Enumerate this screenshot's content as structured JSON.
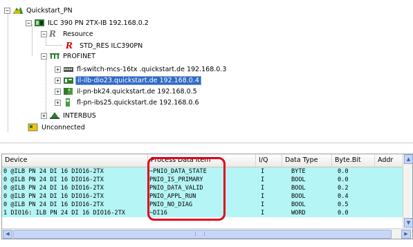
{
  "tree": {
    "root": "Quickstart_PN",
    "controller": "ILC 390 PN 2TX-IB 192.168.0.2",
    "resource": "Resource",
    "std_res": "STD_RES ILC390PN",
    "profinet": "PROFINET",
    "devices": [
      {
        "label": "fl-switch-mcs-16tx .quickstart.de 192.168.0.3",
        "selected": false
      },
      {
        "label": "il-ilb-dio23.quickstart.de 192.168.0.4",
        "selected": true
      },
      {
        "label": "il-pn-bk24.quickstart.de 192.168.0.5",
        "selected": false
      },
      {
        "label": "fl-pn-ibs25.quickstart.de 192.168.0.6",
        "selected": false
      }
    ],
    "interbus": "INTERBUS",
    "unconnected": "Unconnected",
    "expanders": {
      "minus": "−",
      "plus": "+"
    },
    "resource_glyph": "R"
  },
  "table": {
    "columns": [
      "Device",
      "Process Data Item",
      "I/Q",
      "Data Type",
      "Byte.Bit",
      "Addr"
    ],
    "rows": [
      [
        "0 @ILB PN 24 DI 16 DIO16-2TX",
        "~PNIO_DATA_STATE",
        "I",
        "BYTE",
        "0.0"
      ],
      [
        "0 @ILB PN 24 DI 16 DIO16-2TX",
        "PNIO_IS_PRIMARY",
        "I",
        "BOOL",
        "0.0"
      ],
      [
        "0 @ILB PN 24 DI 16 DIO16-2TX",
        "PNIO_DATA_VALID",
        "I",
        "BOOL",
        "0.2"
      ],
      [
        "0 @ILB PN 24 DI 16 DIO16-2TX",
        "PNIO_APPL_RUN",
        "I",
        "BOOL",
        "0.4"
      ],
      [
        "0 @ILB PN 24 DI 16 DIO16-2TX",
        "PNIO_NO_DIAG",
        "I",
        "BOOL",
        "0.5"
      ],
      [
        "1 DIO16: ILB PN 24 DI 16 DIO16-2TX",
        "~DI16",
        "I",
        "WORD",
        "0.0"
      ]
    ],
    "row_color": "#b6f5f5",
    "highlight_color": "#e3001b"
  },
  "scroll": {
    "up": "▲",
    "down": "▼",
    "left": "◀",
    "right": "▶"
  }
}
